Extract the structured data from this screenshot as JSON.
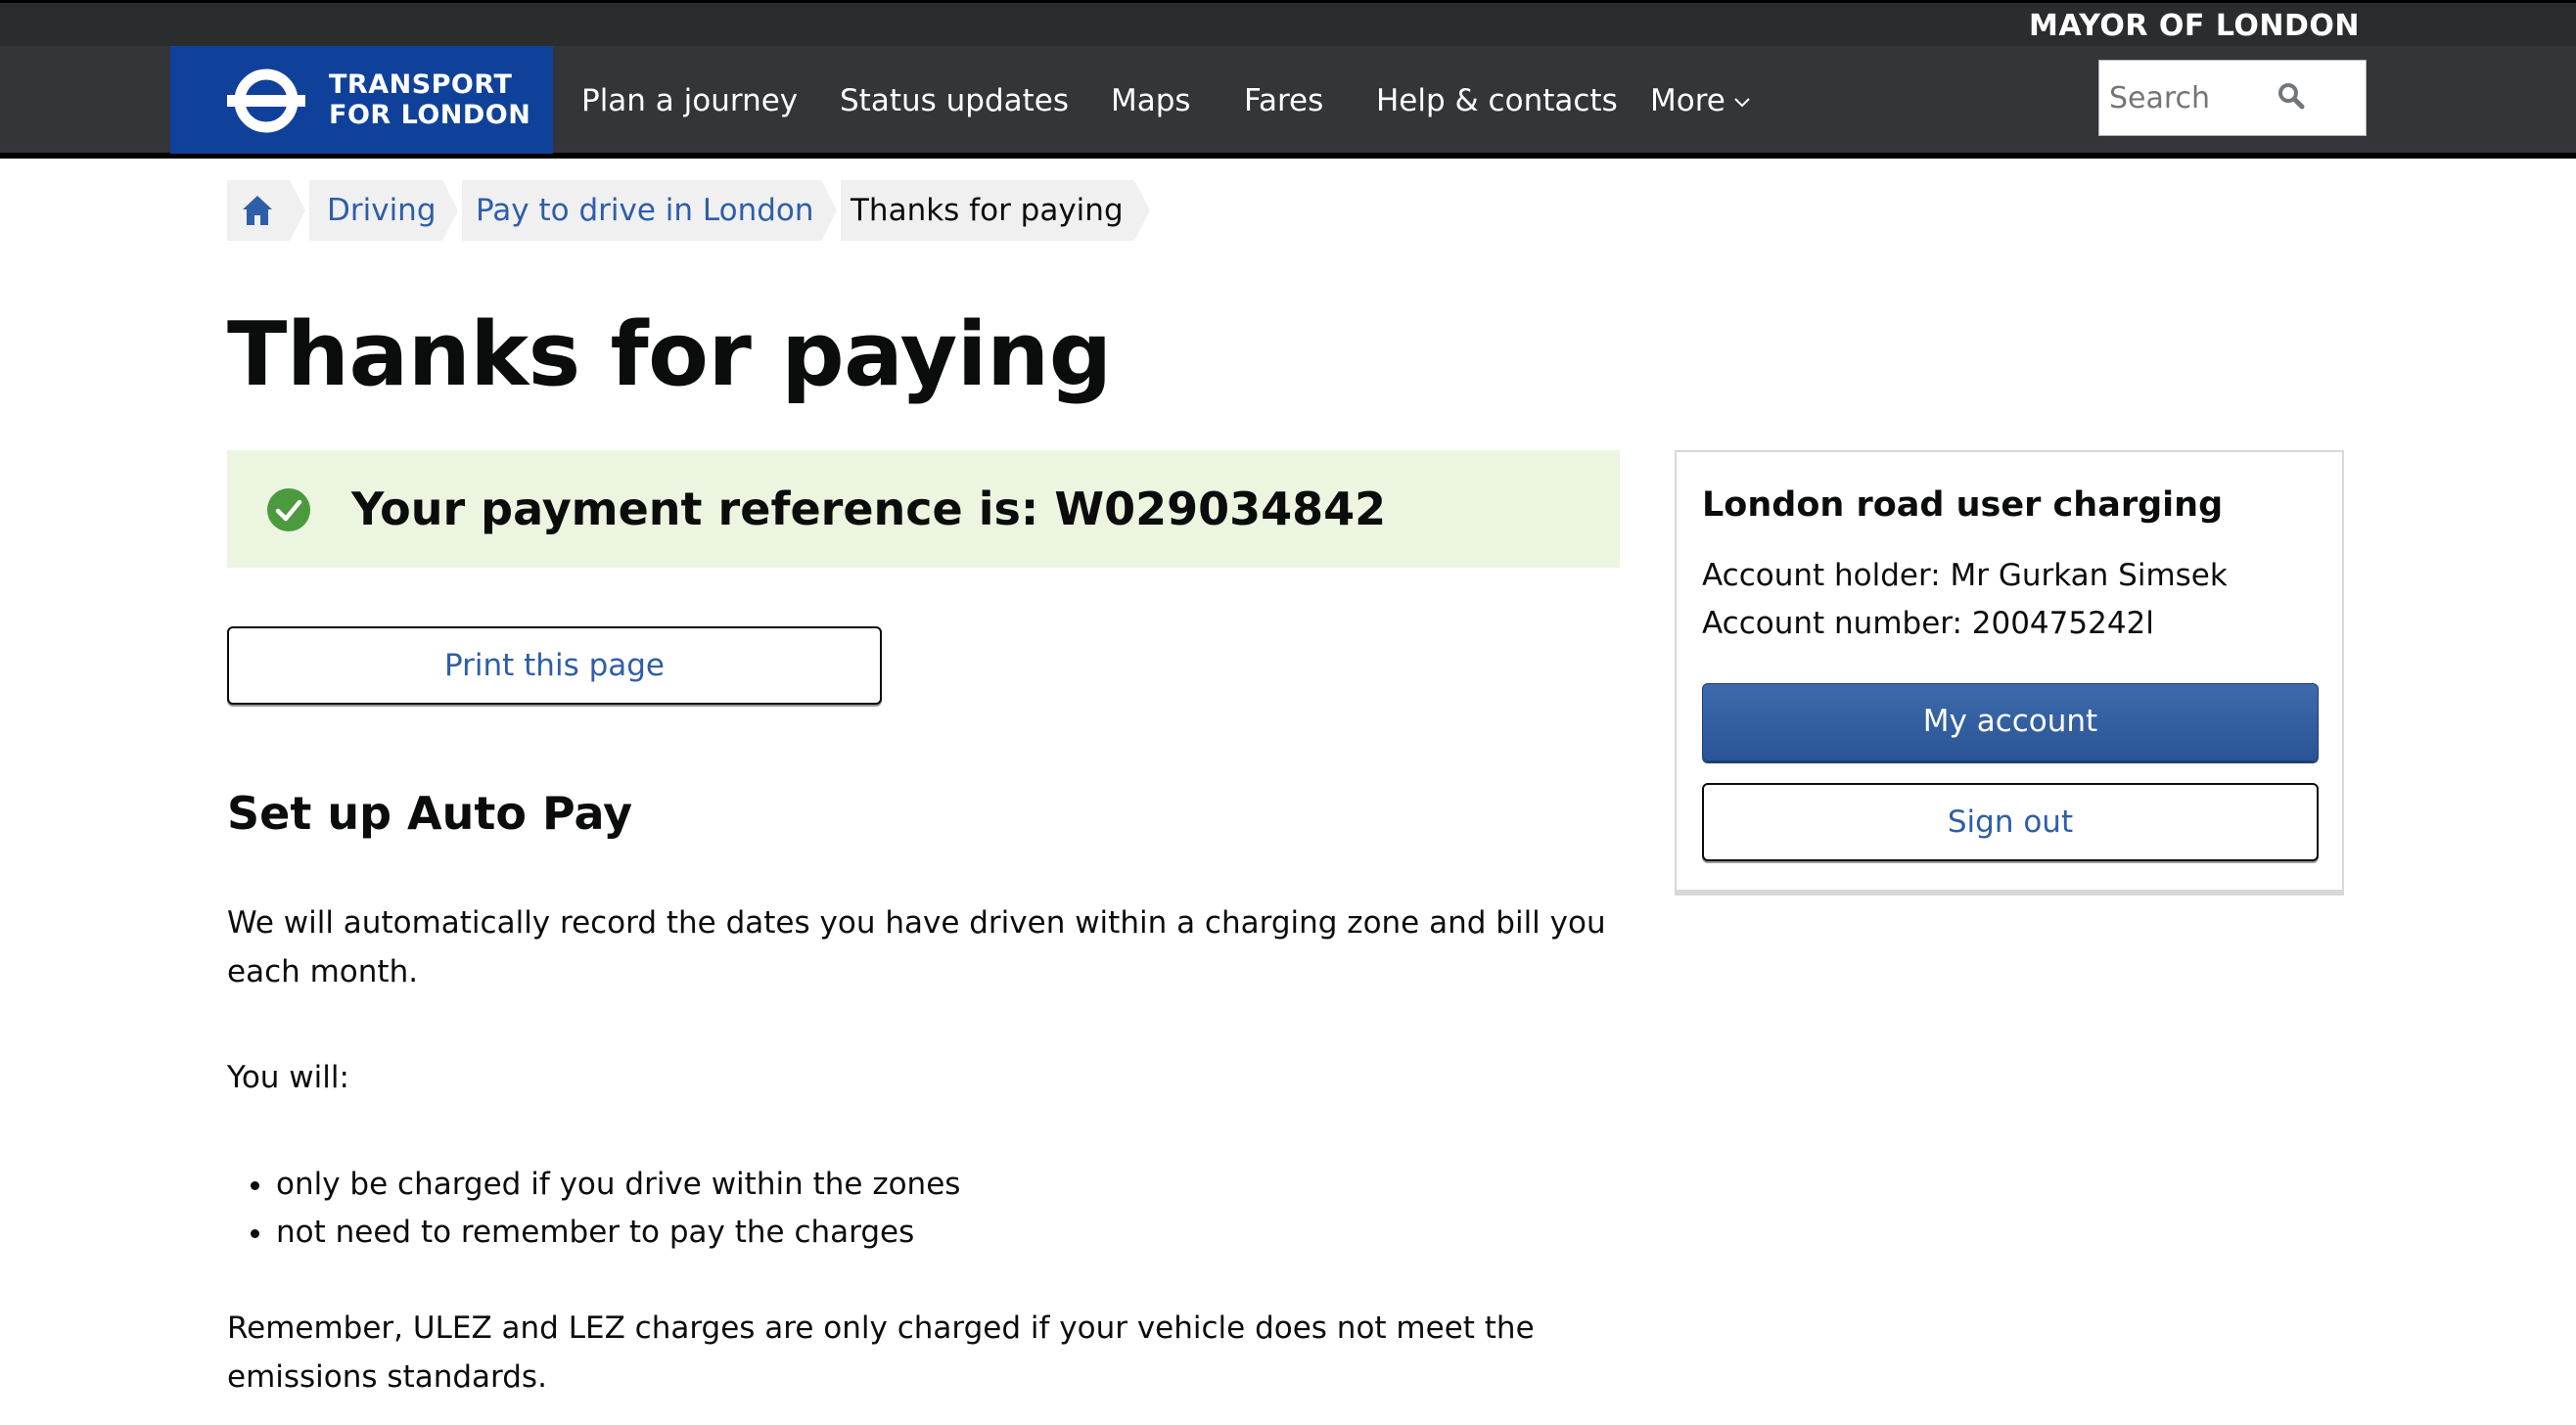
{
  "header": {
    "mayor_text": "MAYOR OF LONDON",
    "logo_line1": "TRANSPORT",
    "logo_line2": "FOR LONDON",
    "nav": [
      {
        "label": "Plan a journey"
      },
      {
        "label": "Status updates"
      },
      {
        "label": "Maps"
      },
      {
        "label": "Fares"
      },
      {
        "label": "Help & contacts"
      },
      {
        "label": "More"
      }
    ],
    "search_placeholder": "Search"
  },
  "breadcrumb": {
    "home_icon": "home-icon",
    "items": [
      {
        "label": "Driving"
      },
      {
        "label": "Pay to drive in London"
      },
      {
        "label": "Thanks for paying"
      }
    ]
  },
  "main": {
    "title": "Thanks for paying",
    "success_message": "Your payment reference is: W029034842",
    "print_button": "Print this page",
    "autopay_heading": "Set up Auto Pay",
    "autopay_intro": "We will automatically record the dates you have driven within a charging zone and bill you each month.",
    "you_will": "You will:",
    "bullets": [
      "only be charged if you drive within the zones",
      "not need to remember to pay the charges"
    ],
    "reminder": "Remember, ULEZ and LEZ charges are only charged if your vehicle does not meet the emissions standards."
  },
  "sidebar": {
    "title": "London road user charging",
    "account_holder": "Account holder: Mr Gurkan Simsek",
    "account_number": "Account number: 200475242l",
    "my_account_button": "My account",
    "sign_out_button": "Sign out"
  },
  "colors": {
    "brand_blue": "#10419a",
    "link_blue": "#2e5ea8",
    "success_bg": "#ebf5df",
    "success_green": "#4c9a3f",
    "nav_bg": "#333538"
  }
}
